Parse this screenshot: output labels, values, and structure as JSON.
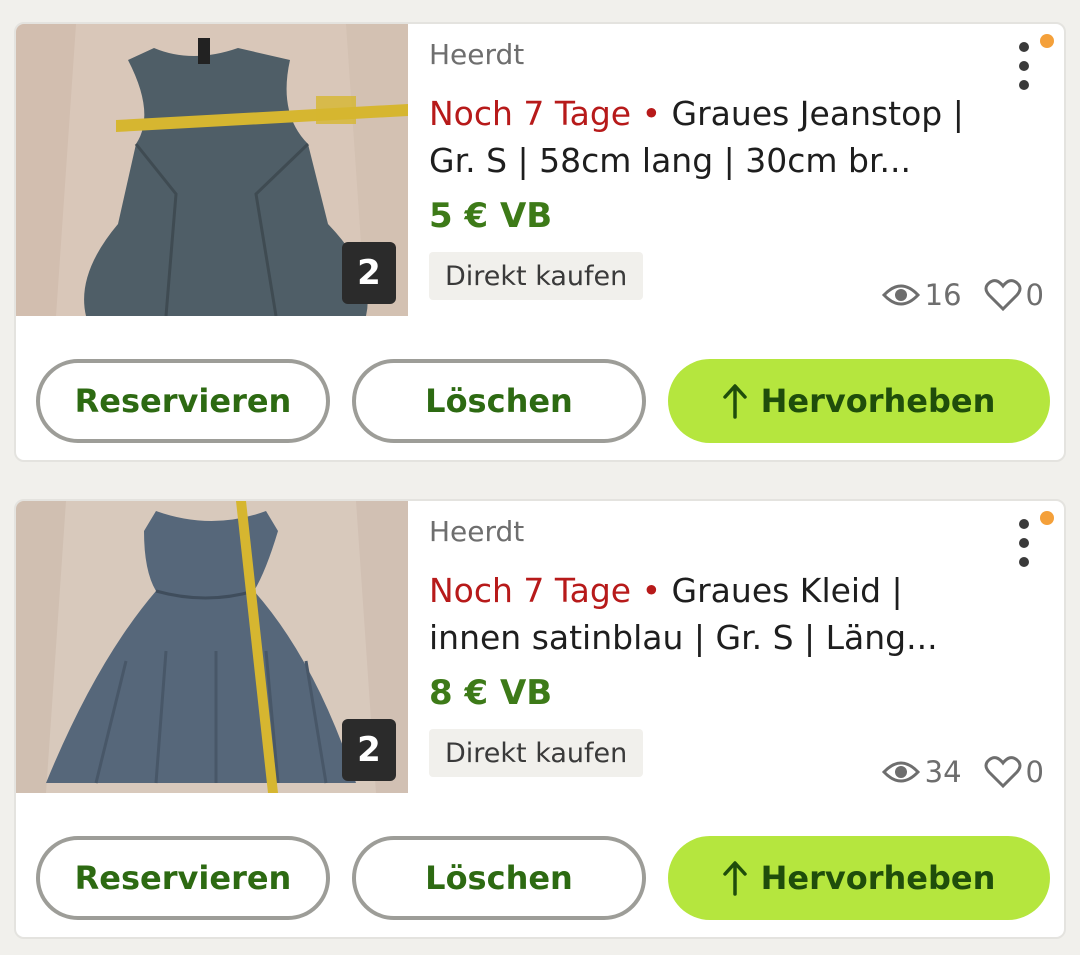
{
  "listings": [
    {
      "location": "Heerdt",
      "expiry": "Noch 7 Tage",
      "separator": "•",
      "title": "Graues Jeanstop | Gr. S | 58cm lang | 30cm br...",
      "price": "5 € VB",
      "tag": "Direkt kaufen",
      "photo_count": "2",
      "views": "16",
      "favorites": "0",
      "actions": {
        "reserve": "Reservieren",
        "delete": "Löschen",
        "highlight": "Hervorheben"
      }
    },
    {
      "location": "Heerdt",
      "expiry": "Noch 7 Tage",
      "separator": "•",
      "title": "Graues Kleid | innen satinblau | Gr. S | Läng...",
      "price": "8 € VB",
      "tag": "Direkt kaufen",
      "photo_count": "2",
      "views": "34",
      "favorites": "0",
      "actions": {
        "reserve": "Reservieren",
        "delete": "Löschen",
        "highlight": "Hervorheben"
      }
    }
  ],
  "icons": {
    "views": "eye-icon",
    "favorites": "heart-icon",
    "menu": "more-vertical-icon",
    "highlight": "arrow-up-icon"
  },
  "colors": {
    "expiry": "#b71a1a",
    "price": "#3d7a18",
    "primary_button": "#b5e63e",
    "notification_dot": "#f4a03a"
  }
}
